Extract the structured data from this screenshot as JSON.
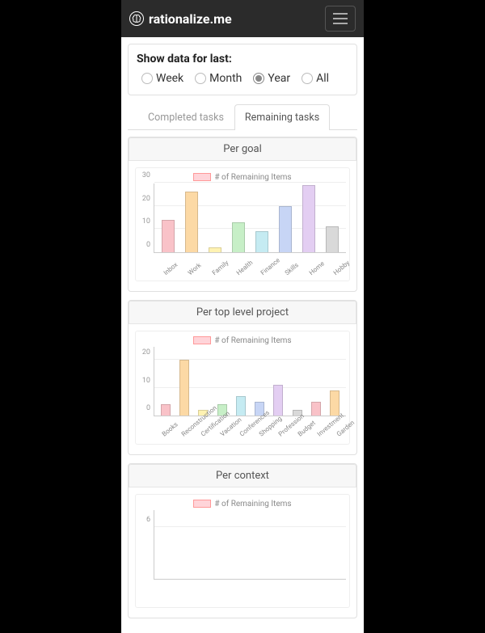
{
  "brand": "rationalize.me",
  "range": {
    "label": "Show data for last:",
    "options": [
      "Week",
      "Month",
      "Year",
      "All"
    ],
    "selected": "Year"
  },
  "tabs": {
    "items": [
      "Completed tasks",
      "Remaining tasks"
    ],
    "active": "Remaining tasks"
  },
  "legend_label": "# of Remaining Items",
  "cards": {
    "goal": "Per goal",
    "project": "Per top level project",
    "context": "Per context"
  },
  "colors": [
    "#f9c2c8",
    "#fcd9a5",
    "#fff2b2",
    "#c7efc7",
    "#c5ebf2",
    "#c7d5f5",
    "#e3cef2",
    "#d9d9d9",
    "#f9c2c8",
    "#fcd9a5",
    "#fff2b2"
  ],
  "chart_data": [
    {
      "id": "goal",
      "type": "bar",
      "title": "Per goal",
      "ylabel": "",
      "xlabel": "",
      "ylim": [
        0,
        30
      ],
      "yticks": [
        0,
        10,
        20,
        30
      ],
      "categories": [
        "Inbox",
        "Work",
        "Family",
        "Health",
        "Finance",
        "Skills",
        "Home",
        "Hobby"
      ],
      "series": [
        {
          "name": "# of Remaining Items",
          "values": [
            14,
            26,
            2,
            13,
            9,
            20,
            29,
            11
          ]
        }
      ]
    },
    {
      "id": "project",
      "type": "bar",
      "title": "Per top level project",
      "ylabel": "",
      "xlabel": "",
      "ylim": [
        0,
        25
      ],
      "yticks": [
        0,
        10,
        20
      ],
      "categories": [
        "Books",
        "Reconstruction",
        "Certification",
        "Vacation",
        "Conferences",
        "Shopping",
        "Profession",
        "Budget",
        "Investment",
        "Garden"
      ],
      "series": [
        {
          "name": "# of Remaining Items",
          "values": [
            4,
            20,
            2,
            4,
            7,
            5,
            11,
            2,
            5,
            9
          ]
        }
      ]
    },
    {
      "id": "context",
      "type": "bar",
      "title": "Per context",
      "ylabel": "",
      "xlabel": "",
      "ylim": [
        0,
        8
      ],
      "yticks": [
        6
      ],
      "categories": [],
      "series": [
        {
          "name": "# of Remaining Items",
          "values": []
        }
      ]
    }
  ]
}
